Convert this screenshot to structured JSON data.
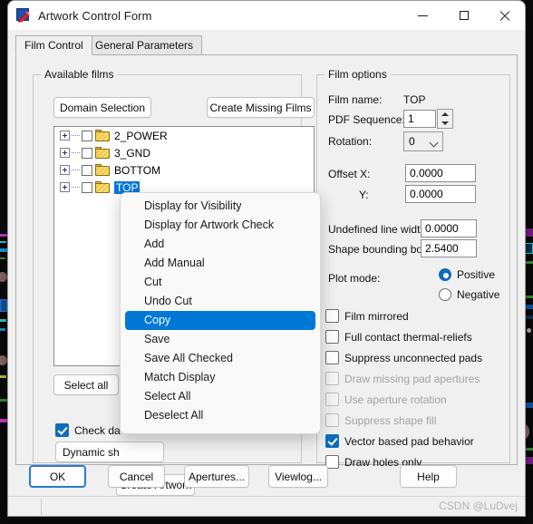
{
  "window": {
    "title": "Artwork Control Form",
    "icon": "artwork-app-icon",
    "minimize": "─",
    "maximize": "□",
    "close": "✕"
  },
  "tabs": [
    {
      "label": "Film Control",
      "active": true
    },
    {
      "label": "General Parameters",
      "active": false
    }
  ],
  "available_films": {
    "group_title": "Available films",
    "domain_selection_label": "Domain Selection",
    "create_missing_films_label": "Create Missing Films",
    "tree": [
      {
        "label": "2_POWER",
        "checked": false,
        "selected": false,
        "expandable": true
      },
      {
        "label": "3_GND",
        "checked": false,
        "selected": false,
        "expandable": true
      },
      {
        "label": "BOTTOM",
        "checked": false,
        "selected": false,
        "expandable": true
      },
      {
        "label": "TOP",
        "checked": false,
        "selected": true,
        "expandable": true
      }
    ],
    "select_all_label": "Select all",
    "check_database_label": "Check da",
    "check_database_checked": true,
    "dynamic_shapes_value": "Dynamic sh",
    "create_artwork_label": "Create Artwork"
  },
  "film_options": {
    "group_title": "Film options",
    "film_name_label": "Film name:",
    "film_name_value": "TOP",
    "pdf_sequence_label": "PDF Sequence:",
    "pdf_sequence_value": "1",
    "rotation_label": "Rotation:",
    "rotation_value": "0",
    "offset_label": "Offset  X:",
    "offset_y_label": "Y:",
    "offset_x_value": "0.0000",
    "offset_y_value": "0.0000",
    "undefined_line_width_label": "Undefined line width:",
    "undefined_line_width_value": "0.0000",
    "shape_bounding_box_label": "Shape bounding box:",
    "shape_bounding_box_value": "2.5400",
    "plot_mode_label": "Plot mode:",
    "plot_positive_label": "Positive",
    "plot_negative_label": "Negative",
    "plot_mode_selected": "Positive",
    "checkboxes": [
      {
        "label": "Film mirrored",
        "checked": false,
        "disabled": false
      },
      {
        "label": "Full contact thermal-reliefs",
        "checked": false,
        "disabled": false
      },
      {
        "label": "Suppress unconnected pads",
        "checked": false,
        "disabled": false
      },
      {
        "label": "Draw missing pad apertures",
        "checked": false,
        "disabled": true
      },
      {
        "label": "Use aperture rotation",
        "checked": false,
        "disabled": true
      },
      {
        "label": "Suppress shape fill",
        "checked": false,
        "disabled": true
      },
      {
        "label": "Vector based pad behavior",
        "checked": true,
        "disabled": false
      },
      {
        "label": "Draw holes only",
        "checked": false,
        "disabled": false
      }
    ]
  },
  "context_menu": {
    "items": [
      {
        "label": "Display for Visibility",
        "highlighted": false
      },
      {
        "label": "Display for Artwork Check",
        "highlighted": false
      },
      {
        "label": "Add",
        "highlighted": false
      },
      {
        "label": "Add Manual",
        "highlighted": false
      },
      {
        "label": "Cut",
        "highlighted": false
      },
      {
        "label": "Undo Cut",
        "highlighted": false
      },
      {
        "label": "Copy",
        "highlighted": true
      },
      {
        "label": "Save",
        "highlighted": false
      },
      {
        "label": "Save All Checked",
        "highlighted": false
      },
      {
        "label": "Match Display",
        "highlighted": false
      },
      {
        "label": "Select All",
        "highlighted": false
      },
      {
        "label": "Deselect All",
        "highlighted": false
      }
    ]
  },
  "footer": {
    "ok_label": "OK",
    "cancel_label": "Cancel",
    "apertures_label": "Apertures...",
    "viewlog_label": "Viewlog...",
    "help_label": "Help",
    "watermark": "CSDN @LuDvej"
  },
  "colors": {
    "accent": "#0078d7",
    "selection": "#0078d7",
    "check_fill": "#0f6cbd",
    "folder": "#efc93f",
    "disabled_text": "#a2a2a2"
  }
}
